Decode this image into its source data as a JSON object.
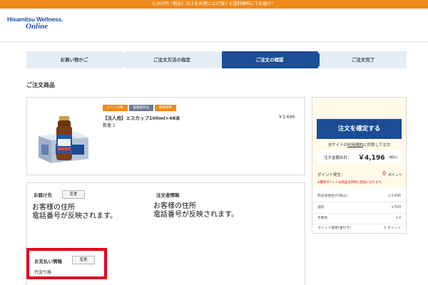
{
  "banner": {
    "text": "5,000円（税込）以上をお買い上げ頂くと送料無料にてお届け！"
  },
  "logo": {
    "line1": "Hisamitsu Wellness.",
    "line2": "Online"
  },
  "steps": [
    {
      "label": "お買い物かご"
    },
    {
      "label": "ご注文方法の指定"
    },
    {
      "label": "ご注文の確認"
    },
    {
      "label": "ご注文完了"
    }
  ],
  "order_section": {
    "title": "ご注文商品"
  },
  "product": {
    "tags": [
      "ドリンク剤",
      "医薬部外品",
      "軽減税率"
    ],
    "name": "【法人用】エスカップ100ml×48本",
    "quantity": "数量:1",
    "price": "￥3,696"
  },
  "delivery": {
    "label": "お届け先",
    "change": "変更",
    "address": "お客様の住所",
    "phone": "電話番号が反映されます。"
  },
  "orderer": {
    "label": "注文者情報",
    "address": "お客様の住所",
    "phone": "電話番号が反映されます。"
  },
  "payment": {
    "label": "お支払い情報",
    "change": "変更",
    "method": "代金引換"
  },
  "sidebar": {
    "confirm_button": "注文を確定する",
    "terms_pre": "当サイトの",
    "terms_link": "利用規約",
    "terms_post": "に同意して注文",
    "total_label": "注文金額合計：",
    "total_value": "￥4,196",
    "total_tax": "(税込)",
    "points_label": "ポイント発生：",
    "points_value": "0",
    "points_unit": "ポイント",
    "points_note": "※獲得ポイントは商品出荷時に発効になります。",
    "rows": [
      {
        "label": "商品金額合計(税込)",
        "value": "￥3,696"
      },
      {
        "label": "送料",
        "value": "￥500"
      },
      {
        "label": "手数料",
        "value": "￥0"
      },
      {
        "label": "ポイント使用(値引き)",
        "value": "0 ポイント"
      }
    ]
  },
  "colors": {
    "accent_blue": "#1a4d93",
    "banner_orange": "#ef8a1b",
    "highlight_red": "#e3001b"
  }
}
